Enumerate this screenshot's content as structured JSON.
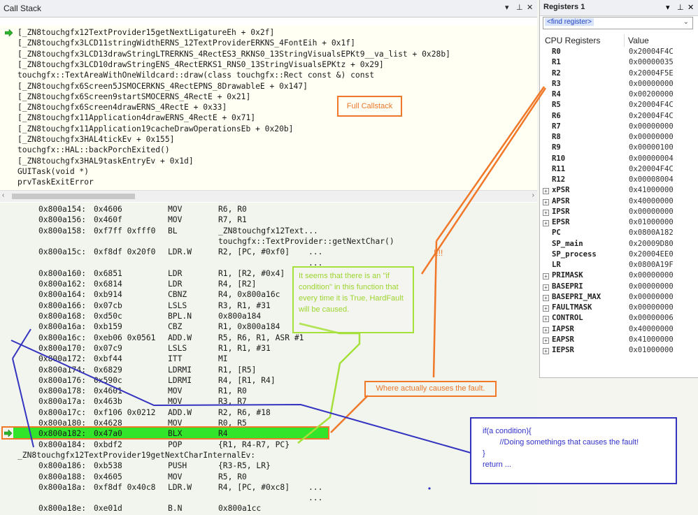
{
  "callstack_panel": {
    "title": "Call Stack",
    "controls": [
      "▾",
      "⊥",
      "✕"
    ],
    "frames": [
      "[_ZN8touchgfx12TextProvider15getNextLigatureEh + 0x2f]",
      "[_ZN8touchgfx3LCD11stringWidthERNS_12TextProviderERKNS_4FontEih + 0x1f]",
      "[_ZN8touchgfx3LCD13drawStringLTRERKNS_4RectES3_RKNS0_13StringVisualsEPKt9__va_list + 0x28b]",
      "[_ZN8touchgfx3LCD10drawStringENS_4RectERKS1_RNS0_13StringVisualsEPKtz + 0x29]",
      "touchgfx::TextAreaWithOneWildcard::draw(class touchgfx::Rect const &) const",
      "[_ZN8touchgfx6Screen5JSMOCERKNS_4RectEPNS_8DrawableE + 0x147]",
      "[_ZN8touchgfx6Screen9startSMOCERNS_4RectE + 0x21]",
      "[_ZN8touchgfx6Screen4drawERNS_4RectE + 0x33]",
      "[_ZN8touchgfx11Application4drawERNS_4RectE + 0x71]",
      "[_ZN8touchgfx11Application19cacheDrawOperationsEb + 0x20b]",
      "[_ZN8touchgfx3HAL4tickEv + 0x155]",
      "touchgfx::HAL::backPorchExited()",
      "[_ZN8touchgfx3HAL9taskEntryEv + 0x1d]",
      "GUITask(void *)",
      "prvTaskExitError"
    ]
  },
  "disassembly": [
    {
      "addr": "0x800a154:",
      "code": "0x4606",
      "mnem": "MOV",
      "ops": "R6, R0"
    },
    {
      "addr": "0x800a156:",
      "code": "0x460f",
      "mnem": "MOV",
      "ops": "R7, R1"
    },
    {
      "addr": "0x800a158:",
      "code": "0xf7ff 0xfff0",
      "mnem": "BL",
      "ops": "_ZN8touchgfx12Text..."
    },
    {
      "addr": "",
      "code": "",
      "mnem": "",
      "ops": "touchgfx::TextProvider::getNextChar()"
    },
    {
      "addr": "0x800a15c:",
      "code": "0xf8df 0x20f0",
      "mnem": "LDR.W",
      "ops": "R2, [PC, #0xf0]",
      "tail": "..."
    },
    {
      "addr": "",
      "code": "",
      "mnem": "",
      "ops": "",
      "tail": "..."
    },
    {
      "addr": "0x800a160:",
      "code": "0x6851",
      "mnem": "LDR",
      "ops": "R1, [R2, #0x4]"
    },
    {
      "addr": "0x800a162:",
      "code": "0x6814",
      "mnem": "LDR",
      "ops": "R4, [R2]"
    },
    {
      "addr": "0x800a164:",
      "code": "0xb914",
      "mnem": "CBNZ",
      "ops": "R4, 0x800a16c"
    },
    {
      "addr": "0x800a166:",
      "code": "0x07cb",
      "mnem": "LSLS",
      "ops": "R3, R1, #31"
    },
    {
      "addr": "0x800a168:",
      "code": "0xd50c",
      "mnem": "BPL.N",
      "ops": "0x800a184"
    },
    {
      "addr": "0x800a16a:",
      "code": "0xb159",
      "mnem": "CBZ",
      "ops": "R1, 0x800a184"
    },
    {
      "addr": "0x800a16c:",
      "code": "0xeb06 0x0561",
      "mnem": "ADD.W",
      "ops": "R5, R6, R1, ASR #1"
    },
    {
      "addr": "0x800a170:",
      "code": "0x07c9",
      "mnem": "LSLS",
      "ops": "R1, R1, #31"
    },
    {
      "addr": "0x800a172:",
      "code": "0xbf44",
      "mnem": "ITT",
      "ops": "MI"
    },
    {
      "addr": "0x800a174:",
      "code": "0x6829",
      "mnem": "LDRMI",
      "ops": "R1, [R5]"
    },
    {
      "addr": "0x800a176:",
      "code": "0x590c",
      "mnem": "LDRMI",
      "ops": "R4, [R1, R4]"
    },
    {
      "addr": "0x800a178:",
      "code": "0x4601",
      "mnem": "MOV",
      "ops": "R1, R0"
    },
    {
      "addr": "0x800a17a:",
      "code": "0x463b",
      "mnem": "MOV",
      "ops": "R3, R7"
    },
    {
      "addr": "0x800a17c:",
      "code": "0xf106 0x0212",
      "mnem": "ADD.W",
      "ops": "R2, R6, #18"
    },
    {
      "addr": "0x800a180:",
      "code": "0x4628",
      "mnem": "MOV",
      "ops": "R0, R5"
    },
    {
      "addr": "0x800a182:",
      "code": "0x47a0",
      "mnem": "BLX",
      "ops": "R4"
    },
    {
      "addr": "0x800a184:",
      "code": "0xbdf2",
      "mnem": "POP",
      "ops": "{R1, R4-R7, PC}"
    },
    {
      "label": "_ZN8touchgfx12TextProvider19getNextCharInternalEv:"
    },
    {
      "addr": "0x800a186:",
      "code": "0xb538",
      "mnem": "PUSH",
      "ops": "{R3-R5, LR}"
    },
    {
      "addr": "0x800a188:",
      "code": "0x4605",
      "mnem": "MOV",
      "ops": "R5, R0"
    },
    {
      "addr": "0x800a18a:",
      "code": "0xf8df 0x40c8",
      "mnem": "LDR.W",
      "ops": "R4, [PC, #0xc8]",
      "tail": "..."
    },
    {
      "addr": "",
      "code": "",
      "mnem": "",
      "ops": "",
      "tail": "..."
    },
    {
      "addr": "0x800a18e:",
      "code": "0xe01d",
      "mnem": "B.N",
      "ops": "0x800a1cc"
    }
  ],
  "registers_panel": {
    "title": "Registers 1",
    "controls": [
      "▾",
      "⊥",
      "✕"
    ],
    "find_placeholder": "<find register>",
    "col_name": "CPU Registers",
    "col_value": "Value",
    "rows": [
      {
        "name": "R0",
        "value": "0x20004F4C",
        "expandable": false
      },
      {
        "name": "R1",
        "value": "0x00000035",
        "expandable": false
      },
      {
        "name": "R2",
        "value": "0x20004F5E",
        "expandable": false
      },
      {
        "name": "R3",
        "value": "0x00000000",
        "expandable": false
      },
      {
        "name": "R4",
        "value": "0x00200000",
        "expandable": false
      },
      {
        "name": "R5",
        "value": "0x20004F4C",
        "expandable": false
      },
      {
        "name": "R6",
        "value": "0x20004F4C",
        "expandable": false
      },
      {
        "name": "R7",
        "value": "0x00000000",
        "expandable": false
      },
      {
        "name": "R8",
        "value": "0x00000000",
        "expandable": false
      },
      {
        "name": "R9",
        "value": "0x00000100",
        "expandable": false
      },
      {
        "name": "R10",
        "value": "0x00000004",
        "expandable": false
      },
      {
        "name": "R11",
        "value": "0x20004F4C",
        "expandable": false
      },
      {
        "name": "R12",
        "value": "0x00008004",
        "expandable": false
      },
      {
        "name": "xPSR",
        "value": "0x41000000",
        "expandable": true
      },
      {
        "name": "APSR",
        "value": "0x40000000",
        "expandable": true
      },
      {
        "name": "IPSR",
        "value": "0x00000000",
        "expandable": true
      },
      {
        "name": "EPSR",
        "value": "0x01000000",
        "expandable": true
      },
      {
        "name": "PC",
        "value": "0x0800A182",
        "expandable": false
      },
      {
        "name": "SP_main",
        "value": "0x20009D80",
        "expandable": false
      },
      {
        "name": "SP_process",
        "value": "0x20004EE0",
        "expandable": false
      },
      {
        "name": "LR",
        "value": "0x0800A19F",
        "expandable": false
      },
      {
        "name": "PRIMASK",
        "value": "0x00000000",
        "expandable": true
      },
      {
        "name": "BASEPRI",
        "value": "0x00000000",
        "expandable": true
      },
      {
        "name": "BASEPRI_MAX",
        "value": "0x00000000",
        "expandable": true
      },
      {
        "name": "FAULTMASK",
        "value": "0x00000000",
        "expandable": true
      },
      {
        "name": "CONTROL",
        "value": "0x00000006",
        "expandable": true
      },
      {
        "name": "IAPSR",
        "value": "0x40000000",
        "expandable": true
      },
      {
        "name": "EAPSR",
        "value": "0x41000000",
        "expandable": true
      },
      {
        "name": "IEPSR",
        "value": "0x01000000",
        "expandable": true
      }
    ]
  },
  "annotations": {
    "full_callstack": "Full Callstack",
    "if_condition_note": "It seems that there is an \"if condition\" in this function that every time it is True, HardFault will be caused.",
    "where_fault": "Where actually causes the fault.",
    "exclaim": "!!!!",
    "code_lines": [
      "if(a condition){",
      "        //Doing somethings that causes the fault!",
      "}",
      "return ..."
    ]
  },
  "colors": {
    "orange": "#f07828",
    "green_note": "#a6e03a",
    "blue_note": "#3434c0",
    "current_line": "#33e52a"
  },
  "icons": {
    "current_frame": "green-arrow-icon",
    "expand": "expand-plus-icon"
  }
}
